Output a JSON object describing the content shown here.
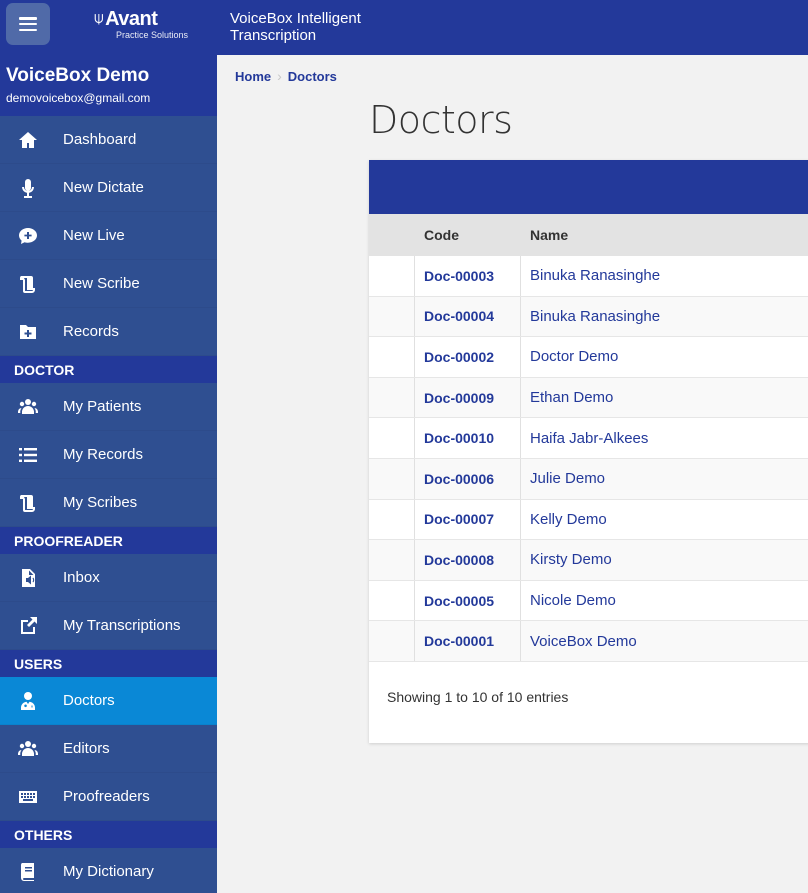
{
  "header": {
    "logo_text": "Avant",
    "logo_sub": "Practice Solutions",
    "app_title": "VoiceBox Intelligent Transcription"
  },
  "profile": {
    "name": "VoiceBox Demo",
    "email": "demovoicebox@gmail.com"
  },
  "sidebar": {
    "main": [
      {
        "label": "Dashboard",
        "icon": "home-icon"
      },
      {
        "label": "New Dictate",
        "icon": "microphone-icon"
      },
      {
        "label": "New Live",
        "icon": "chat-plus-icon"
      },
      {
        "label": "New Scribe",
        "icon": "scroll-icon"
      },
      {
        "label": "Records",
        "icon": "folder-plus-icon"
      }
    ],
    "sections": [
      {
        "title": "DOCTOR",
        "items": [
          {
            "label": "My Patients",
            "icon": "users-icon"
          },
          {
            "label": "My Records",
            "icon": "list-icon"
          },
          {
            "label": "My Scribes",
            "icon": "scroll-icon"
          }
        ]
      },
      {
        "title": "PROOFREADER",
        "items": [
          {
            "label": "Inbox",
            "icon": "audio-file-icon"
          },
          {
            "label": "My Transcriptions",
            "icon": "external-link-icon"
          }
        ]
      },
      {
        "title": "USERS",
        "items": [
          {
            "label": "Doctors",
            "icon": "doctor-icon",
            "active": true
          },
          {
            "label": "Editors",
            "icon": "users-icon"
          },
          {
            "label": "Proofreaders",
            "icon": "keyboard-icon"
          }
        ]
      },
      {
        "title": "OTHERS",
        "items": [
          {
            "label": "My Dictionary",
            "icon": "book-icon"
          }
        ]
      }
    ]
  },
  "breadcrumb": {
    "home": "Home",
    "current": "Doctors"
  },
  "page": {
    "title": "Doctors"
  },
  "table": {
    "headers": {
      "code": "Code",
      "name": "Name"
    },
    "rows": [
      {
        "code": "Doc-00003",
        "name": "Binuka Ranasinghe"
      },
      {
        "code": "Doc-00004",
        "name": "Binuka Ranasinghe"
      },
      {
        "code": "Doc-00002",
        "name": "Doctor Demo"
      },
      {
        "code": "Doc-00009",
        "name": "Ethan Demo"
      },
      {
        "code": "Doc-00010",
        "name": "Haifa Jabr-Alkees"
      },
      {
        "code": "Doc-00006",
        "name": "Julie Demo"
      },
      {
        "code": "Doc-00007",
        "name": "Kelly Demo"
      },
      {
        "code": "Doc-00008",
        "name": "Kirsty Demo"
      },
      {
        "code": "Doc-00005",
        "name": "Nicole Demo"
      },
      {
        "code": "Doc-00001",
        "name": "VoiceBox Demo"
      }
    ],
    "footer": "Showing 1 to 10 of 10 entries"
  },
  "colors": {
    "primary": "#23399a",
    "sidebar": "#2f4f91",
    "active": "#0a88d6"
  }
}
